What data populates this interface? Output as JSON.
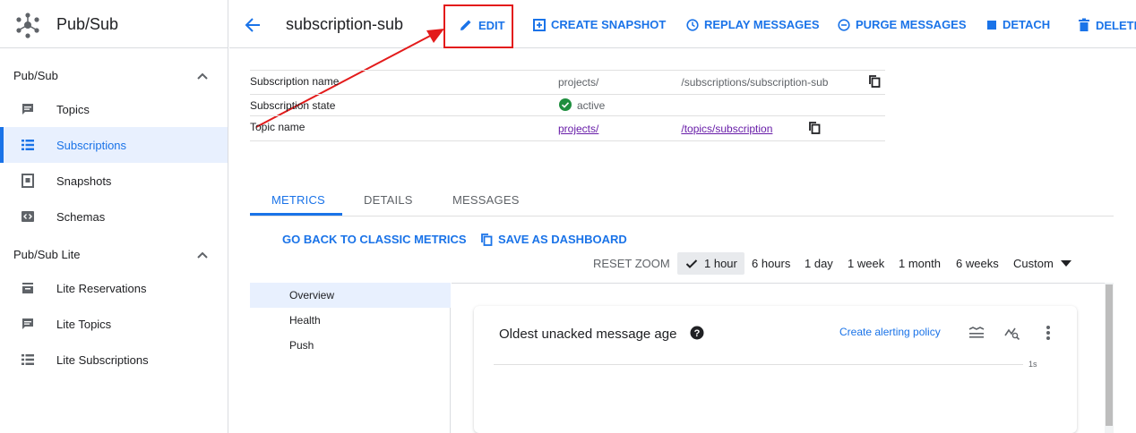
{
  "brand": {
    "title": "Pub/Sub"
  },
  "sidebar": {
    "sections": [
      {
        "title": "Pub/Sub",
        "items": [
          {
            "label": "Topics",
            "icon": "message-icon"
          },
          {
            "label": "Subscriptions",
            "icon": "list-icon",
            "active": true
          },
          {
            "label": "Snapshots",
            "icon": "snapshot-icon"
          },
          {
            "label": "Schemas",
            "icon": "code-icon"
          }
        ]
      },
      {
        "title": "Pub/Sub Lite",
        "items": [
          {
            "label": "Lite Reservations",
            "icon": "reservations-icon"
          },
          {
            "label": "Lite Topics",
            "icon": "message-icon"
          },
          {
            "label": "Lite Subscriptions",
            "icon": "list-icon"
          }
        ]
      }
    ]
  },
  "header": {
    "title": "subscription-sub",
    "actions": {
      "edit": "EDIT",
      "create_snapshot": "CREATE SNAPSHOT",
      "replay": "REPLAY MESSAGES",
      "purge": "PURGE MESSAGES",
      "detach": "DETACH",
      "delete": "DELETE"
    }
  },
  "details": {
    "subscription_name": {
      "label": "Subscription name",
      "value_prefix": "projects/",
      "value_suffix": "/subscriptions/subscription-sub"
    },
    "subscription_state": {
      "label": "Subscription state",
      "value": "active"
    },
    "topic_name": {
      "label": "Topic name",
      "value_prefix": "projects/",
      "value_suffix": "/topics/subscription"
    }
  },
  "tabs": {
    "metrics": "METRICS",
    "details": "DETAILS",
    "messages": "MESSAGES"
  },
  "metrics": {
    "classic_link": "GO BACK TO CLASSIC METRICS",
    "save_dashboard": "SAVE AS DASHBOARD",
    "reset_zoom": "RESET ZOOM",
    "time_ranges": [
      "1 hour",
      "6 hours",
      "1 day",
      "1 week",
      "1 month",
      "6 weeks",
      "Custom"
    ],
    "selected_range": "1 hour",
    "nav": [
      "Overview",
      "Health",
      "Push"
    ],
    "card": {
      "title": "Oldest unacked message age",
      "alert_link": "Create alerting policy",
      "tick_label": "1s"
    }
  },
  "colors": {
    "accent": "#1a73e8",
    "annotation": "#e31b1b",
    "active_status": "#1e8e3e",
    "link_visited": "#681da8"
  }
}
